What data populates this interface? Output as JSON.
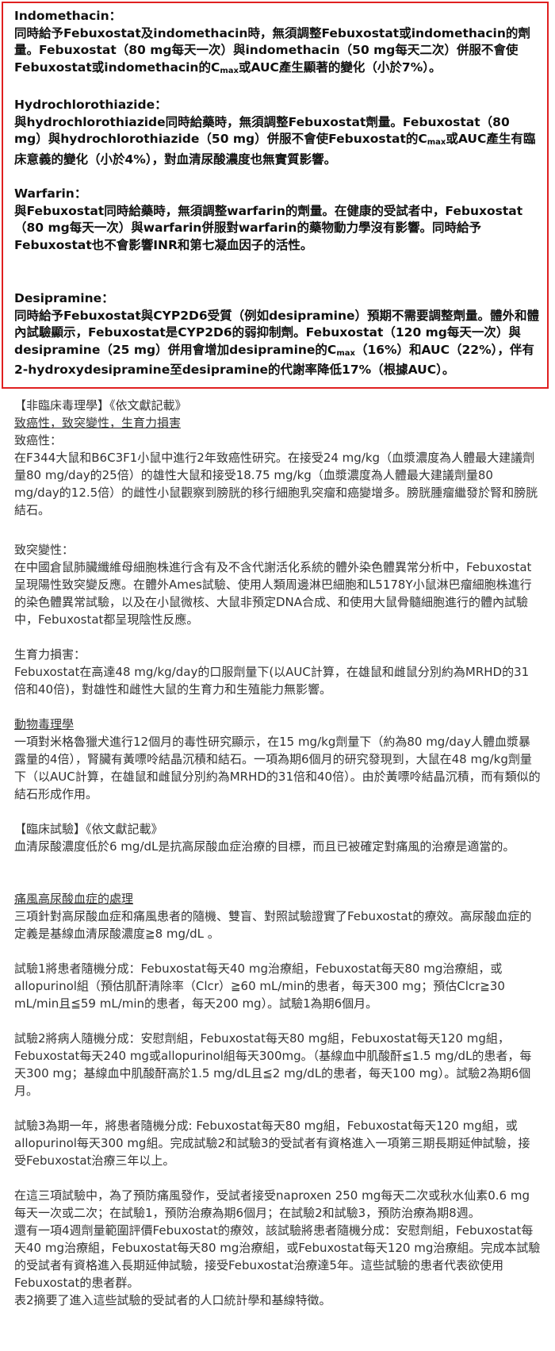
{
  "boxed": {
    "indomethacin": {
      "title": "Indomethacin：",
      "t1": "同時給予Febuxostat及indomethacin時，無須調整Febuxostat或indomethacin的劑量。Febuxostat（80 mg每天一次）與indomethacin（50 mg每天二次）併服不會使Febuxostat或indomethacin的C",
      "sub": "max",
      "t2": "或AUC產生顯著的變化（小於7%）。"
    },
    "hctz": {
      "title": "Hydrochlorothiazide：",
      "t1": "與hydrochlorothiazide同時給藥時，無須調整Febuxostat劑量。Febuxostat（80 mg）與hydrochlorothiazide（50 mg）併服不會使Febuxostat的C",
      "sub": "max",
      "t2": "或AUC產生有臨床意義的變化（小於4%），對血清尿酸濃度也無實質影響。"
    },
    "warfarin": {
      "title": "Warfarin：",
      "text": "與Febuxostat同時給藥時，無須調整warfarin的劑量。在健康的受試者中，Febuxostat（80 mg每天一次）與warfarin併服對warfarin的藥物動力學沒有影響。同時給予Febuxostat也不會影響INR和第七凝血因子的活性。"
    },
    "desipramine": {
      "title": "Desipramine：",
      "t1": "同時給予Febuxostat與CYP2D6受質（例如desipramine）預期不需要調整劑量。體外和體內試驗顯示，Febuxostat是CYP2D6的弱抑制劑。Febuxostat（120 mg每天一次）與desipramine（25 mg）併用會增加desipramine的C",
      "sub": "max",
      "t2": "（16%）和AUC（22%），伴有2-hydroxydesipramine至desipramine的代謝率降低17%（根據AUC）。"
    }
  },
  "nonclinical": {
    "heading": "【非臨床毒理學】《依文獻記載》",
    "sub_heading": "致癌性，致突變性，生育力損害",
    "carc_title": "致癌性：",
    "carc_text": "在F344大鼠和B6C3F1小鼠中進行2年致癌性研究。在接受24 mg/kg（血漿濃度為人體最大建議劑量80 mg/day的25倍）的雄性大鼠和接受18.75 mg/kg（血漿濃度為人體最大建議劑量80 mg/day的12.5倍）的雌性小鼠觀察到膀胱的移行細胞乳突瘤和癌變增多。膀胱腫瘤繼發於腎和膀胱結石。",
    "mut_title": "致突變性：",
    "mut_text": "在中國倉鼠肺臟纖維母細胞株進行含有及不含代謝活化系統的體外染色體異常分析中，Febuxostat呈現陽性致突變反應。在體外Ames試驗、使用人類周邊淋巴細胞和L5178Y小鼠淋巴瘤細胞株進行的染色體異常試驗，以及在小鼠微核、大鼠非預定DNA合成、和使用大鼠骨髓細胞進行的體內試驗中，Febuxostat都呈現陰性反應。",
    "fert_title": "生育力損害：",
    "fert_text": "Febuxostat在高達48 mg/kg/day的口服劑量下(以AUC計算，在雄鼠和雌鼠分別約為MRHD的31倍和40倍)，對雄性和雌性大鼠的生育力和生殖能力無影響。",
    "tox_title": "動物毒理學",
    "tox_text": "一項對米格魯獵犬進行12個月的毒性研究顯示，在15 mg/kg劑量下（約為80 mg/day人體血漿暴露量的4倍），腎臟有黃嘌呤結晶沉積和結石。一項為期6個月的研究發現到，大鼠在48 mg/kg劑量下（以AUC計算，在雄鼠和雌鼠分別約為MRHD的31倍和40倍）。由於黃嘌呤結晶沉積，而有類似的結石形成作用。"
  },
  "clinical": {
    "heading": "【臨床試驗】《依文獻記載》",
    "intro": "血清尿酸濃度低於6 mg/dL是抗高尿酸血症治療的目標，而且已被確定對痛風的治療是適當的。",
    "sub_heading": "痛風高尿酸血症的處理",
    "p1": "三項針對高尿酸血症和痛風患者的隨機、雙盲、對照試驗證實了Febuxostat的療效。高尿酸血症的定義是基線血清尿酸濃度≧8 mg/dL 。",
    "p2": "試驗1將患者隨機分成：Febuxostat每天40 mg治療組，Febuxostat每天80 mg治療組，或allopurinol組（預估肌酐清除率（Clcr）≧60 mL/min的患者，每天300 mg；預估Clcr≧30 mL/min且≦59 mL/min的患者，每天200 mg）。試驗1為期6個月。",
    "p3": "試驗2將病人隨機分成：安慰劑組，Febuxostat每天80 mg組，Febuxostat每天120 mg組，Febuxostat每天240 mg或allopurinol組每天300mg。（基線血中肌酸酐≦1.5 mg/dL的患者，每天300 mg；基線血中肌酸酐高於1.5 mg/dL且≦2 mg/dL的患者，每天100 mg）。試驗2為期6個月。",
    "p4": "試驗3為期一年，將患者隨機分成: Febuxostat每天80 mg組，Febuxostat每天120 mg組，或allopurinol每天300 mg組。完成試驗2和試驗3的受試者有資格進入一項第三期長期延伸試驗，接受Febuxostat治療三年以上。",
    "p5": "在這三項試驗中，為了預防痛風發作，受試者接受naproxen 250 mg每天二次或秋水仙素0.6 mg每天一次或二次；在試驗1，預防治療為期6個月；在試驗2和試驗3，預防治療為期8週。",
    "p6": "還有一項4週劑量範圍評價Febuxostat的療效，該試驗將患者隨機分成：安慰劑組，Febuxostat每天40 mg治療組，Febuxostat每天80 mg治療組，或Febuxostat每天120 mg治療組。完成本試驗的受試者有資格進入長期延伸試驗，接受Febuxostat治療達5年。這些試驗的患者代表欲使用Febuxostat的患者群。",
    "p7": "表2摘要了進入這些試驗的受試者的人口統計學和基線特徵。"
  }
}
